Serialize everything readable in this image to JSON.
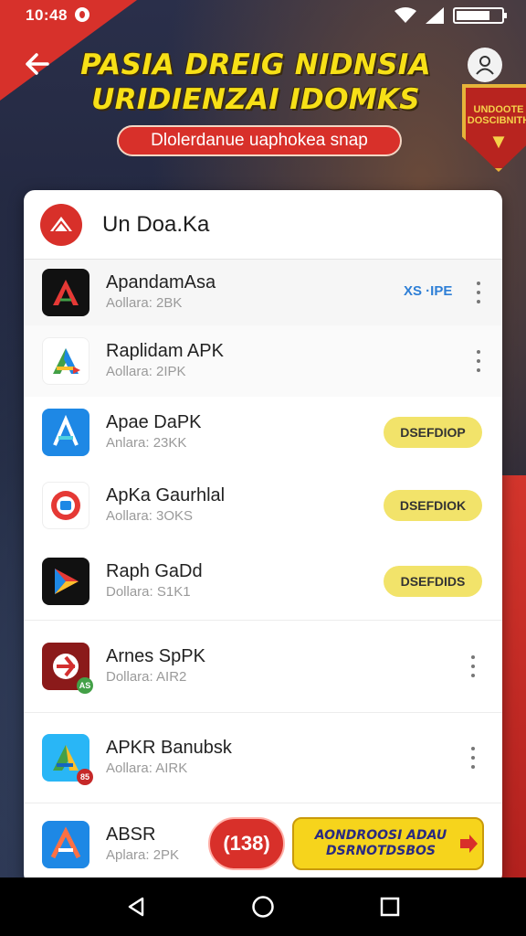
{
  "status_bar": {
    "time": "10:48"
  },
  "banner": {
    "headline_line1": "PASIA DREIG NIDNSIA",
    "headline_line2": "URIDIENZAI IDOMKS",
    "subtitle": "Dlolerdanue uaphokea snap",
    "badge_text": "UNDOOTE DOSCIBNITH"
  },
  "card": {
    "title": "Un Doa.Ka"
  },
  "apps": [
    {
      "name": "ApandamAsa",
      "meta": "Aollara: 2BK",
      "action": "XS ·IPE",
      "action_type": "link"
    },
    {
      "name": "Raplidam APK",
      "meta": "Aollara: 2IPK",
      "action": "",
      "action_type": "menu"
    },
    {
      "name": "Apae DaPK",
      "meta": "Anlara: 23KK",
      "action": "DSEFDIOP",
      "action_type": "button"
    },
    {
      "name": "ApKa Gaurhlal",
      "meta": "Aollara: 3OKS",
      "action": "DSEFDIOK",
      "action_type": "button"
    },
    {
      "name": "Raph GaDd",
      "meta": "Dollara: S1K1",
      "action": "DSEFDIDS",
      "action_type": "button"
    },
    {
      "name": "Arnes SpPK",
      "meta": "Dollara: AIR2",
      "action": "",
      "action_type": "menu"
    },
    {
      "name": "APKR Banubsk",
      "meta": "Aollara: AIRK",
      "action": "",
      "action_type": "menu"
    },
    {
      "name": "ABSR",
      "meta": "Aplara: 2PK",
      "action": "",
      "action_type": "none"
    }
  ],
  "floating": {
    "count": "(138)",
    "promo_text": "AONDROOSI ADAU DSRNOTDSBOS"
  },
  "icons": {
    "back": "back-arrow-icon",
    "profile": "person-icon",
    "wifi": "wifi-icon",
    "signal": "signal-icon",
    "battery": "battery-icon",
    "nav_back": "triangle-back-icon",
    "nav_home": "circle-home-icon",
    "nav_recent": "square-recent-icon"
  },
  "colors": {
    "accent_red": "#d8302a",
    "headline_yellow": "#f7e017",
    "button_yellow": "#f2e36a",
    "link_blue": "#2e7fd6"
  }
}
